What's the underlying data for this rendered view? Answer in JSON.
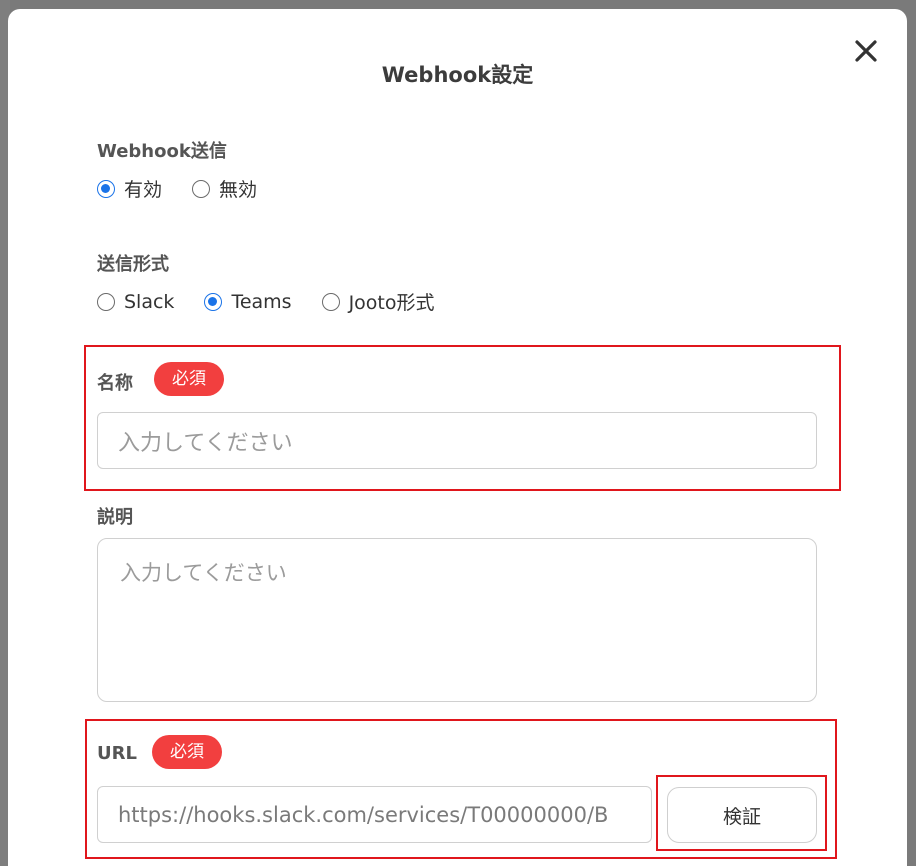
{
  "dialog": {
    "title": "Webhook設定",
    "close_icon": "close-icon"
  },
  "webhook_send": {
    "label": "Webhook送信",
    "options": [
      {
        "label": "有効",
        "checked": true
      },
      {
        "label": "無効",
        "checked": false
      }
    ]
  },
  "send_format": {
    "label": "送信形式",
    "options": [
      {
        "label": "Slack",
        "checked": false
      },
      {
        "label": "Teams",
        "checked": true
      },
      {
        "label": "Jooto形式",
        "checked": false
      }
    ]
  },
  "name_field": {
    "label": "名称",
    "required_badge": "必須",
    "placeholder": "入力してください"
  },
  "description_field": {
    "label": "説明",
    "placeholder": "入力してください"
  },
  "url_field": {
    "label": "URL",
    "required_badge": "必須",
    "value": "https://hooks.slack.com/services/T00000000/B",
    "verify_button": "検証"
  },
  "colors": {
    "accent": "#1a73e8",
    "required": "#f23f3f",
    "highlight": "#e0161c"
  }
}
